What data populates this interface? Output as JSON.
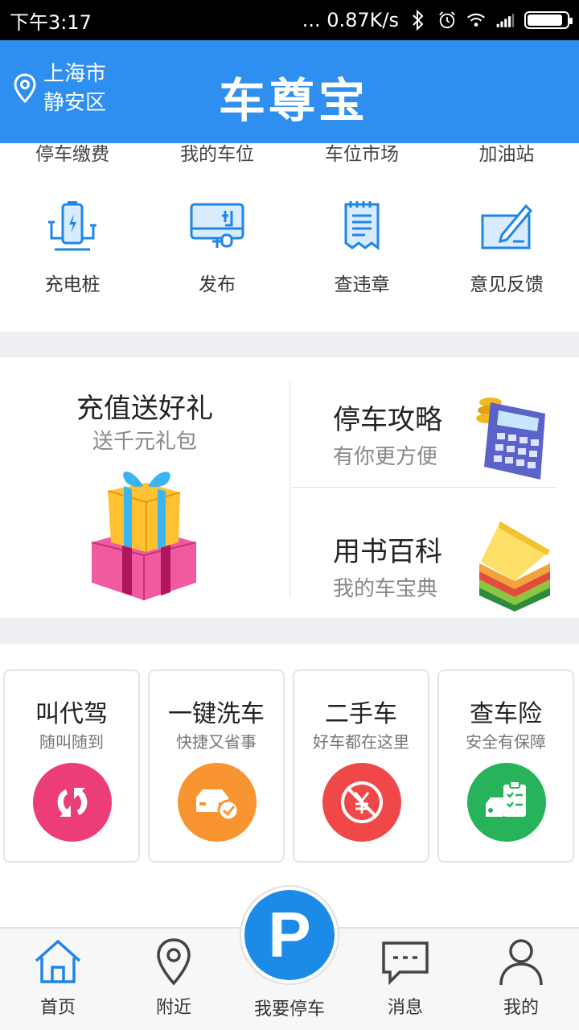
{
  "status_bar": {
    "time": "下午3:17",
    "network_speed": "... 0.87K/s",
    "battery_level": 0.9
  },
  "header": {
    "city": "上海市",
    "district": "静安区",
    "brand": "车尊宝"
  },
  "top_row": [
    "停车缴费",
    "我的车位",
    "车位市场",
    "加油站"
  ],
  "icon_row": [
    {
      "label": "充电桩",
      "icon": "charging-pile-icon"
    },
    {
      "label": "发布",
      "icon": "publish-icon"
    },
    {
      "label": "查违章",
      "icon": "violation-notepad-icon"
    },
    {
      "label": "意见反馈",
      "icon": "feedback-pen-icon"
    }
  ],
  "promo": {
    "left_title": "充值送好礼",
    "left_sub": "送千元礼包",
    "right_top_title": "停车攻略",
    "right_top_sub": "有你更方便",
    "right_bottom_title": "用书百科",
    "right_bottom_sub": "我的车宝典"
  },
  "cards": [
    {
      "title": "叫代驾",
      "sub": "随叫随到",
      "color": "#ec3d7a",
      "icon": "refresh-icon"
    },
    {
      "title": "一键洗车",
      "sub": "快捷又省事",
      "color": "#f99530",
      "icon": "car-wash-icon"
    },
    {
      "title": "二手车",
      "sub": "好车都在这里",
      "color": "#f04848",
      "icon": "used-car-icon"
    },
    {
      "title": "查车险",
      "sub": "安全有保障",
      "color": "#26b35a",
      "icon": "insurance-icon"
    }
  ],
  "nav": {
    "home": "首页",
    "nearby": "附近",
    "park": "我要停车",
    "park_letter": "P",
    "messages": "消息",
    "mine": "我的"
  },
  "colors": {
    "primary": "#2f8ff0",
    "band": "#eeeff3"
  }
}
